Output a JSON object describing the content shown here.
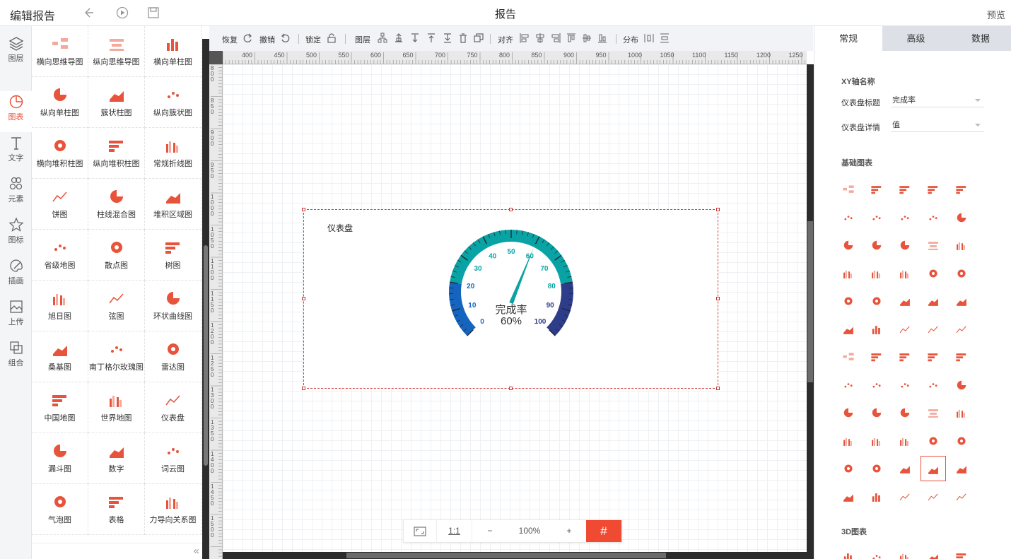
{
  "topbar": {
    "title": "编辑报告",
    "center": "报告",
    "preview": "预览"
  },
  "leftnav": [
    {
      "label": "图层",
      "icon": "layers-icon"
    },
    {
      "label": "图表",
      "icon": "chart-icon",
      "active": true
    },
    {
      "label": "文字",
      "icon": "text-icon"
    },
    {
      "label": "元素",
      "icon": "element-icon"
    },
    {
      "label": "图标",
      "icon": "star-icon"
    },
    {
      "label": "插画",
      "icon": "palette-icon"
    },
    {
      "label": "上传",
      "icon": "upload-icon"
    },
    {
      "label": "组合",
      "icon": "group-icon"
    }
  ],
  "palette": [
    "横向思维导图",
    "纵向思维导图",
    "横向单柱图",
    "纵向单柱图",
    "簇状柱图",
    "纵向簇状图",
    "横向堆积柱图",
    "纵向堆积柱图",
    "常规折线图",
    "饼图",
    "柱线混合图",
    "堆积区域图",
    "省级地图",
    "散点图",
    "树图",
    "旭日图",
    "弦图",
    "环状曲线图",
    "桑基图",
    "南丁格尔玫瑰图",
    "雷达图",
    "中国地图",
    "世界地图",
    "仪表盘",
    "漏斗图",
    "数字",
    "词云图",
    "气泡图",
    "表格",
    "力导向关系图"
  ],
  "toolbar": {
    "redo": "恢复",
    "undo": "撤销",
    "lock": "锁定",
    "layer": "图层",
    "align": "对齐",
    "distribute": "分布"
  },
  "ruler": {
    "top": [
      "400",
      "450",
      "500",
      "550",
      "600",
      "650",
      "700",
      "750",
      "800",
      "850",
      "900",
      "950",
      "1000",
      "1050",
      "1100",
      "1150",
      "1200",
      "1250"
    ],
    "left": [
      "800",
      "850",
      "900",
      "950",
      "1000",
      "1050",
      "1100",
      "1150",
      "1200",
      "1250",
      "1300",
      "1350",
      "1400",
      "1450",
      "1500"
    ]
  },
  "chart": {
    "title": "仪表盘"
  },
  "chart_data": {
    "type": "gauge",
    "title": "仪表盘",
    "min": 0,
    "max": 100,
    "value": 60,
    "ticks": [
      0,
      10,
      20,
      30,
      40,
      50,
      60,
      70,
      80,
      90,
      100
    ],
    "label": "完成率",
    "value_label": "60%",
    "band_colors": [
      "#1565c0",
      "#0aa3a5",
      "#2e3d8a"
    ],
    "bands": [
      [
        0,
        20
      ],
      [
        20,
        80
      ],
      [
        80,
        100
      ]
    ]
  },
  "zoom": {
    "fit": "",
    "ratio": "1:1",
    "minus": "−",
    "level": "100%",
    "plus": "+",
    "grid": "#"
  },
  "rpanel": {
    "tabs": [
      "常规",
      "高级",
      "数据"
    ],
    "xy_section": "XY轴名称",
    "fields": [
      {
        "label": "仪表盘标题",
        "value": "完成率"
      },
      {
        "label": "仪表盘详情",
        "value": "值"
      }
    ],
    "basic_section": "基础图表",
    "threed_section": "3D图表"
  },
  "colors": {
    "accent": "#e8533b",
    "primary": "#f04a33"
  }
}
